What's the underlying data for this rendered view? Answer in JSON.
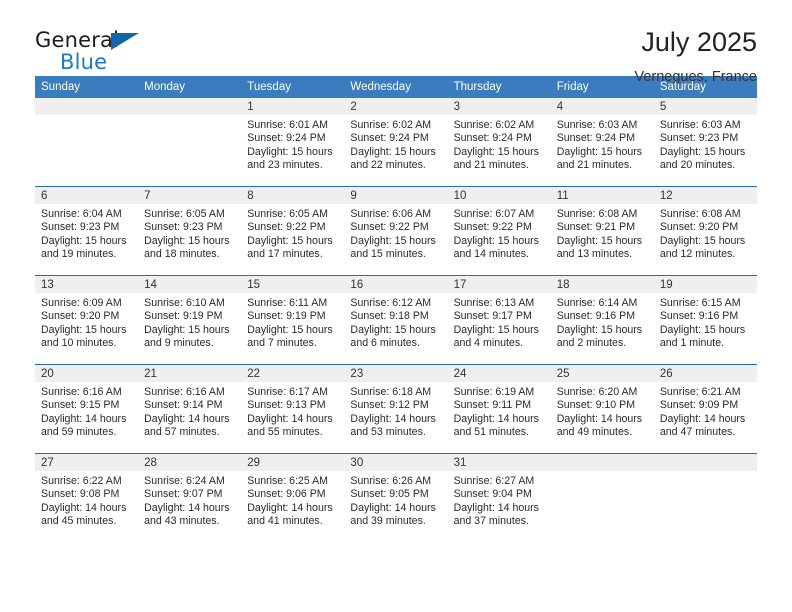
{
  "brand": {
    "name_top": "General",
    "name_bottom": "Blue",
    "triangle_color": "#1565ad",
    "blue_text_color": "#1c7bc4"
  },
  "header": {
    "title": "July 2025",
    "location": "Vernegues, France",
    "header_bg": "#3a7cbd",
    "row_divider": "#2b6cad",
    "daynum_bg": "#efefef"
  },
  "weekday_headers": [
    "Sunday",
    "Monday",
    "Tuesday",
    "Wednesday",
    "Thursday",
    "Friday",
    "Saturday"
  ],
  "labels": {
    "sunrise_prefix": "Sunrise: ",
    "sunset_prefix": "Sunset: ",
    "daylight_prefix": "Daylight: "
  },
  "weeks": [
    [
      {
        "day": "",
        "empty": true
      },
      {
        "day": "",
        "empty": true
      },
      {
        "day": "1",
        "sunrise": "Sunrise: 6:01 AM",
        "sunset": "Sunset: 9:24 PM",
        "daylight": "Daylight: 15 hours and 23 minutes."
      },
      {
        "day": "2",
        "sunrise": "Sunrise: 6:02 AM",
        "sunset": "Sunset: 9:24 PM",
        "daylight": "Daylight: 15 hours and 22 minutes."
      },
      {
        "day": "3",
        "sunrise": "Sunrise: 6:02 AM",
        "sunset": "Sunset: 9:24 PM",
        "daylight": "Daylight: 15 hours and 21 minutes."
      },
      {
        "day": "4",
        "sunrise": "Sunrise: 6:03 AM",
        "sunset": "Sunset: 9:24 PM",
        "daylight": "Daylight: 15 hours and 21 minutes."
      },
      {
        "day": "5",
        "sunrise": "Sunrise: 6:03 AM",
        "sunset": "Sunset: 9:23 PM",
        "daylight": "Daylight: 15 hours and 20 minutes."
      }
    ],
    [
      {
        "day": "6",
        "sunrise": "Sunrise: 6:04 AM",
        "sunset": "Sunset: 9:23 PM",
        "daylight": "Daylight: 15 hours and 19 minutes."
      },
      {
        "day": "7",
        "sunrise": "Sunrise: 6:05 AM",
        "sunset": "Sunset: 9:23 PM",
        "daylight": "Daylight: 15 hours and 18 minutes."
      },
      {
        "day": "8",
        "sunrise": "Sunrise: 6:05 AM",
        "sunset": "Sunset: 9:22 PM",
        "daylight": "Daylight: 15 hours and 17 minutes."
      },
      {
        "day": "9",
        "sunrise": "Sunrise: 6:06 AM",
        "sunset": "Sunset: 9:22 PM",
        "daylight": "Daylight: 15 hours and 15 minutes."
      },
      {
        "day": "10",
        "sunrise": "Sunrise: 6:07 AM",
        "sunset": "Sunset: 9:22 PM",
        "daylight": "Daylight: 15 hours and 14 minutes."
      },
      {
        "day": "11",
        "sunrise": "Sunrise: 6:08 AM",
        "sunset": "Sunset: 9:21 PM",
        "daylight": "Daylight: 15 hours and 13 minutes."
      },
      {
        "day": "12",
        "sunrise": "Sunrise: 6:08 AM",
        "sunset": "Sunset: 9:20 PM",
        "daylight": "Daylight: 15 hours and 12 minutes."
      }
    ],
    [
      {
        "day": "13",
        "sunrise": "Sunrise: 6:09 AM",
        "sunset": "Sunset: 9:20 PM",
        "daylight": "Daylight: 15 hours and 10 minutes."
      },
      {
        "day": "14",
        "sunrise": "Sunrise: 6:10 AM",
        "sunset": "Sunset: 9:19 PM",
        "daylight": "Daylight: 15 hours and 9 minutes."
      },
      {
        "day": "15",
        "sunrise": "Sunrise: 6:11 AM",
        "sunset": "Sunset: 9:19 PM",
        "daylight": "Daylight: 15 hours and 7 minutes."
      },
      {
        "day": "16",
        "sunrise": "Sunrise: 6:12 AM",
        "sunset": "Sunset: 9:18 PM",
        "daylight": "Daylight: 15 hours and 6 minutes."
      },
      {
        "day": "17",
        "sunrise": "Sunrise: 6:13 AM",
        "sunset": "Sunset: 9:17 PM",
        "daylight": "Daylight: 15 hours and 4 minutes."
      },
      {
        "day": "18",
        "sunrise": "Sunrise: 6:14 AM",
        "sunset": "Sunset: 9:16 PM",
        "daylight": "Daylight: 15 hours and 2 minutes."
      },
      {
        "day": "19",
        "sunrise": "Sunrise: 6:15 AM",
        "sunset": "Sunset: 9:16 PM",
        "daylight": "Daylight: 15 hours and 1 minute."
      }
    ],
    [
      {
        "day": "20",
        "sunrise": "Sunrise: 6:16 AM",
        "sunset": "Sunset: 9:15 PM",
        "daylight": "Daylight: 14 hours and 59 minutes."
      },
      {
        "day": "21",
        "sunrise": "Sunrise: 6:16 AM",
        "sunset": "Sunset: 9:14 PM",
        "daylight": "Daylight: 14 hours and 57 minutes."
      },
      {
        "day": "22",
        "sunrise": "Sunrise: 6:17 AM",
        "sunset": "Sunset: 9:13 PM",
        "daylight": "Daylight: 14 hours and 55 minutes."
      },
      {
        "day": "23",
        "sunrise": "Sunrise: 6:18 AM",
        "sunset": "Sunset: 9:12 PM",
        "daylight": "Daylight: 14 hours and 53 minutes."
      },
      {
        "day": "24",
        "sunrise": "Sunrise: 6:19 AM",
        "sunset": "Sunset: 9:11 PM",
        "daylight": "Daylight: 14 hours and 51 minutes."
      },
      {
        "day": "25",
        "sunrise": "Sunrise: 6:20 AM",
        "sunset": "Sunset: 9:10 PM",
        "daylight": "Daylight: 14 hours and 49 minutes."
      },
      {
        "day": "26",
        "sunrise": "Sunrise: 6:21 AM",
        "sunset": "Sunset: 9:09 PM",
        "daylight": "Daylight: 14 hours and 47 minutes."
      }
    ],
    [
      {
        "day": "27",
        "sunrise": "Sunrise: 6:22 AM",
        "sunset": "Sunset: 9:08 PM",
        "daylight": "Daylight: 14 hours and 45 minutes."
      },
      {
        "day": "28",
        "sunrise": "Sunrise: 6:24 AM",
        "sunset": "Sunset: 9:07 PM",
        "daylight": "Daylight: 14 hours and 43 minutes."
      },
      {
        "day": "29",
        "sunrise": "Sunrise: 6:25 AM",
        "sunset": "Sunset: 9:06 PM",
        "daylight": "Daylight: 14 hours and 41 minutes."
      },
      {
        "day": "30",
        "sunrise": "Sunrise: 6:26 AM",
        "sunset": "Sunset: 9:05 PM",
        "daylight": "Daylight: 14 hours and 39 minutes."
      },
      {
        "day": "31",
        "sunrise": "Sunrise: 6:27 AM",
        "sunset": "Sunset: 9:04 PM",
        "daylight": "Daylight: 14 hours and 37 minutes."
      },
      {
        "day": "",
        "empty": true
      },
      {
        "day": "",
        "empty": true
      }
    ]
  ]
}
